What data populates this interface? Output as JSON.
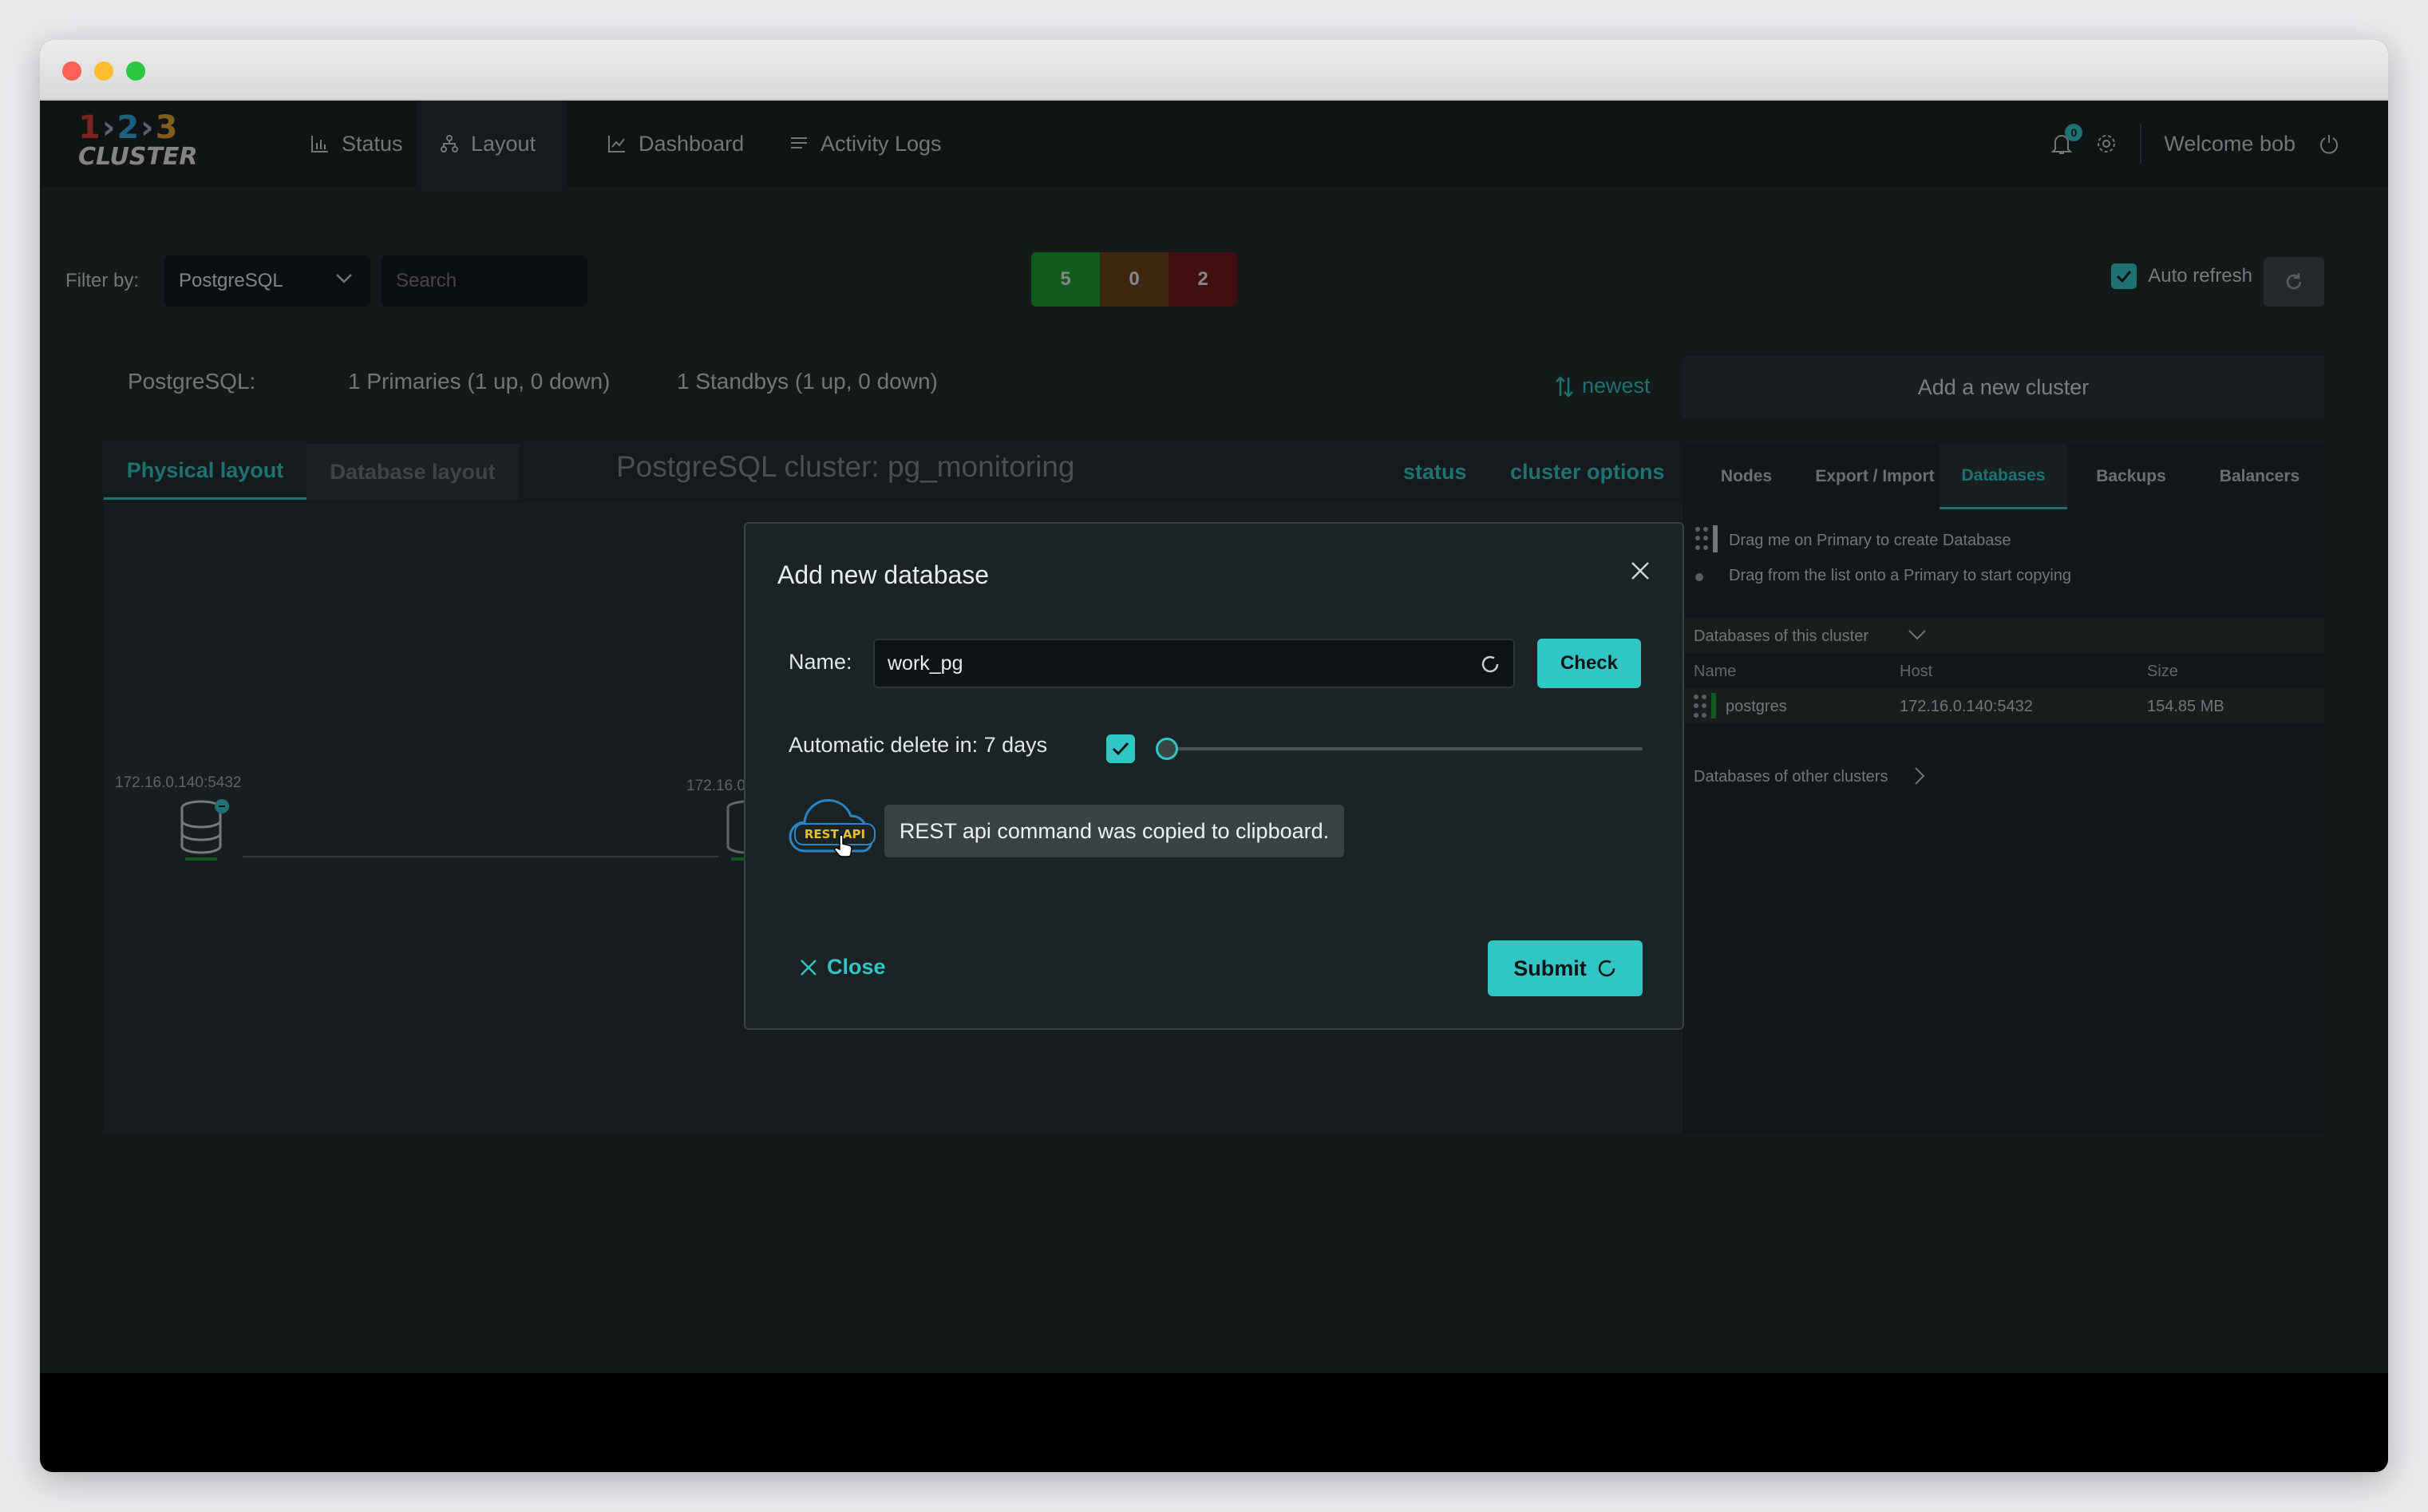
{
  "window": {
    "traffic_lights": {
      "close": "#fe5f57",
      "minimize": "#febc2e",
      "zoom": "#28c840"
    }
  },
  "nav": {
    "logo": {
      "num1": "1",
      "num2": "2",
      "num3": "3",
      "text": "CLUSTER",
      "colors": {
        "n1": "#d63a2f",
        "n2": "#2aa6d9",
        "n3": "#e3a02f"
      }
    },
    "items": [
      {
        "label": "Status",
        "icon": "bar-chart-icon"
      },
      {
        "label": "Layout",
        "icon": "sitemap-icon"
      },
      {
        "label": "Dashboard",
        "icon": "line-chart-icon"
      },
      {
        "label": "Activity Logs",
        "icon": "list-icon"
      }
    ],
    "notifications_count": "0",
    "welcome": "Welcome bob"
  },
  "filter": {
    "label": "Filter by:",
    "selected": "PostgreSQL",
    "search_placeholder": "Search",
    "counts": [
      {
        "value": "5",
        "color": "#179a2b"
      },
      {
        "value": "0",
        "color": "#6a3b0e"
      },
      {
        "value": "2",
        "color": "#6e1114"
      }
    ],
    "auto_refresh_label": "Auto refresh"
  },
  "summary": {
    "type_label": "PostgreSQL:",
    "primaries": "1 Primaries (1 up, 0 down)",
    "standbys": "1 Standbys (1 up, 0 down)",
    "sort_label": "newest",
    "add_cluster": "Add a new cluster"
  },
  "canvas": {
    "tabs": [
      "Physical layout",
      "Database layout"
    ],
    "title": "PostgreSQL cluster: pg_monitoring",
    "links": [
      "status",
      "cluster options"
    ],
    "node1_label": "172.16.0.140:5432",
    "node2_label": "172.16.0"
  },
  "right_panel": {
    "tabs": [
      "Nodes",
      "Export / Import",
      "Databases",
      "Backups",
      "Balancers"
    ],
    "drag_hint": "Drag me on Primary to create Database",
    "copy_hint": "Drag from the list onto a Primary to start copying",
    "this_cluster_title": "Databases of this cluster",
    "columns": [
      "Name",
      "Host",
      "Size"
    ],
    "rows": [
      {
        "name": "postgres",
        "host": "172.16.0.140:5432",
        "size": "154.85 MB"
      }
    ],
    "other_clusters": "Databases of other clusters"
  },
  "modal": {
    "title": "Add new database",
    "name_label": "Name:",
    "name_value": "work_pg",
    "check_label": "Check",
    "auto_delete_label": "Automatic delete in: 7 days",
    "rest_label": "REST API",
    "tooltip": "REST api command was copied to clipboard.",
    "close_label": "Close",
    "submit_label": "Submit"
  }
}
